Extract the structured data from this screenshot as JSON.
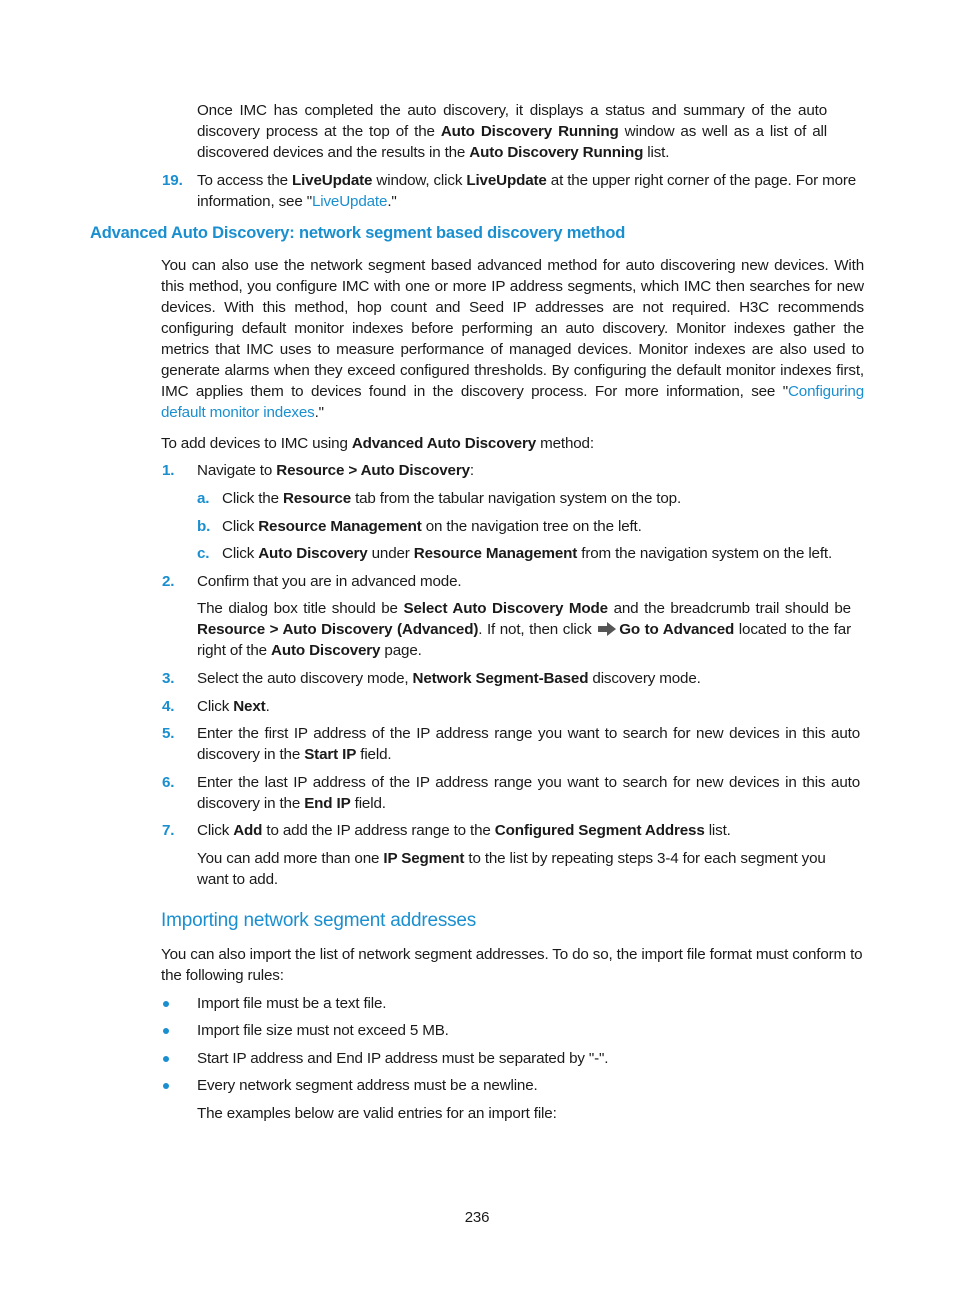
{
  "intro": {
    "para": {
      "t1": "Once IMC has completed the auto discovery, it displays a status and summary of the auto discovery process at the top of the ",
      "b1": "Auto Discovery Running",
      "t2": " window as well as a list of all discovered devices and the results in the ",
      "b2": "Auto Discovery Running",
      "t3": " list."
    },
    "step19": {
      "num": "19.",
      "t1": "To access the ",
      "b1": "LiveUpdate",
      "t2": " window, click ",
      "b2": "LiveUpdate",
      "t3": " at the upper right corner of the page. For more information, see \"",
      "link": "LiveUpdate",
      "t4": ".\""
    }
  },
  "section": {
    "heading": "Advanced Auto Discovery: network segment based discovery method",
    "para": {
      "t1": "You can also use the network segment based advanced method for auto discovering new devices. With this method, you configure IMC with one or more IP address segments, which IMC then searches for new devices. With this method, hop count and Seed IP addresses are not required. H3C recommends configuring default monitor indexes before performing an auto discovery. Monitor indexes gather the metrics that IMC uses to measure performance of managed devices. Monitor indexes are also used to generate alarms when they exceed configured thresholds. By configuring the default monitor indexes first, IMC applies them to devices found in the discovery process. For more information, see \"",
      "link": "Configuring default monitor indexes",
      "t2": ".\""
    },
    "lead": {
      "t1": "To add devices to IMC using ",
      "b1": "Advanced Auto Discovery",
      "t2": " method:"
    },
    "steps": [
      {
        "num": "1.",
        "t1": "Navigate to ",
        "b1": "Resource > Auto Discovery",
        "t2": ":",
        "substeps": [
          {
            "num": "a.",
            "t1": "Click the ",
            "b1": "Resource",
            "t2": " tab from the tabular navigation system on the top."
          },
          {
            "num": "b.",
            "t1": "Click ",
            "b1": "Resource Management",
            "t2": " on the navigation tree on the left."
          },
          {
            "num": "c.",
            "t1": "Click ",
            "b1": "Auto Discovery",
            "t2": " under ",
            "b2": "Resource Management",
            "t3": " from the navigation system on the left."
          }
        ]
      },
      {
        "num": "2.",
        "t1": "Confirm that you are in advanced mode.",
        "note": {
          "t1": "The dialog box title should be ",
          "b1": "Select Auto Discovery Mode",
          "t2": " and the breadcrumb trail should be ",
          "b2": "Resource > Auto Discovery (Advanced)",
          "t3": ". If not, then click ",
          "icon": "arrow-right-icon",
          "b3": "Go to Advanced",
          "t4": " located to the far right of the ",
          "b4": "Auto Discovery",
          "t5": " page."
        }
      },
      {
        "num": "3.",
        "t1": "Select the auto discovery mode, ",
        "b1": "Network Segment-Based",
        "t2": " discovery mode."
      },
      {
        "num": "4.",
        "t1": "Click ",
        "b1": "Next",
        "t2": "."
      },
      {
        "num": "5.",
        "t1": "Enter the first IP address of the IP address range you want to search for new devices in this auto discovery in the ",
        "b1": "Start IP",
        "t2": " field."
      },
      {
        "num": "6.",
        "t1": "Enter the last IP address of the IP address range you want to search for new devices in this auto discovery in the ",
        "b1": "End IP",
        "t2": " field."
      },
      {
        "num": "7.",
        "t1": "Click ",
        "b1": "Add",
        "t2": " to add the IP address range to the ",
        "b2": "Configured Segment Address",
        "t3": " list.",
        "note": {
          "t1": "You can add more than one ",
          "b1": "IP Segment",
          "t2": " to the list by repeating steps 3-4 for each segment you want to add."
        }
      }
    ]
  },
  "subsection": {
    "heading": "Importing network segment addresses",
    "para": "You can also import the list of network segment addresses. To do so, the import file format must conform to the following rules:",
    "bullets": [
      "Import file must be a text file.",
      "Import file size must not exceed 5 MB.",
      "Start IP address and End IP address must be separated by \"-\".",
      "Every network segment address must be a newline."
    ],
    "after": "The examples below are valid entries for an import file:"
  },
  "footer": {
    "page_number": "236"
  },
  "colors": {
    "accent": "#1a8fd0",
    "text": "#1a1a1a"
  }
}
